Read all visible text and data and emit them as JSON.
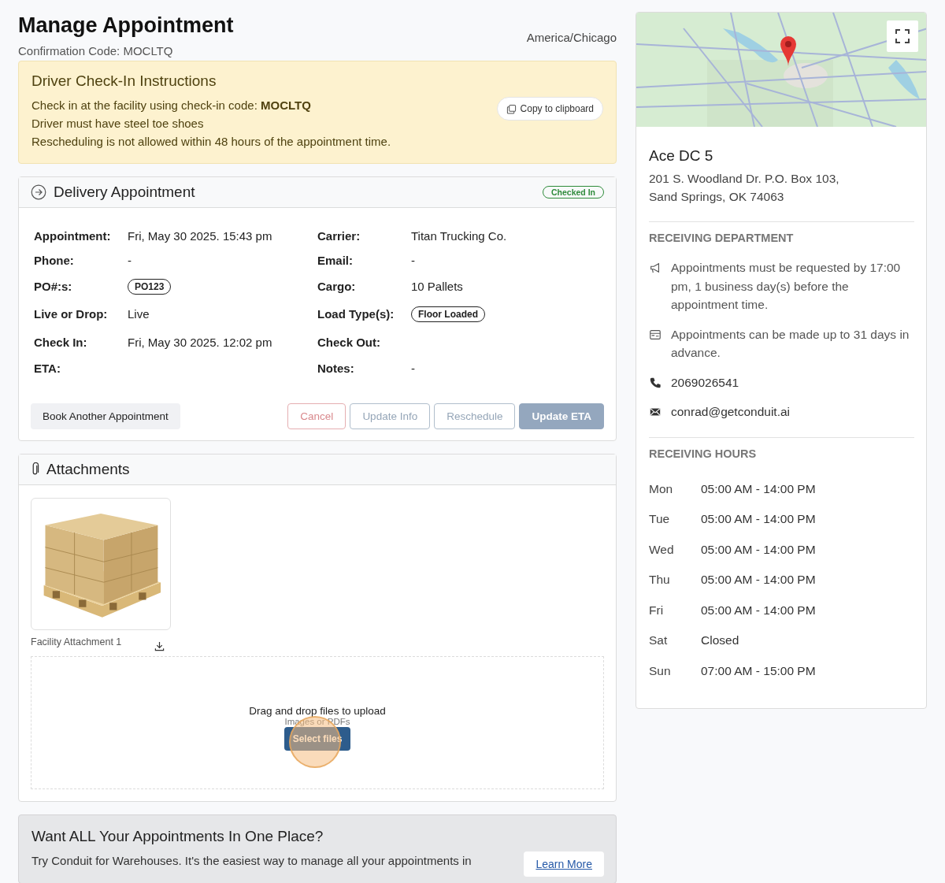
{
  "header": {
    "title": "Manage Appointment",
    "confirmation": "Confirmation Code: MOCLTQ",
    "timezone": "America/Chicago"
  },
  "instructions": {
    "title": "Driver Check-In Instructions",
    "lines": [
      "Check in at the facility using check-in code: **MOCLTQ**",
      "Driver must have steel toe shoes",
      "Rescheduling is not allowed within 48 hours of the appointment time."
    ],
    "copy_button": "Copy to clipboard"
  },
  "appointment": {
    "title": "Delivery Appointment",
    "status": "Checked In",
    "fields": [
      {
        "label": "Appointment:",
        "kind": "text",
        "value": "Fri, May 30 2025. 15:43 pm"
      },
      {
        "label": "Carrier:",
        "kind": "text",
        "value": "Titan Trucking Co."
      },
      {
        "label": "Phone:",
        "kind": "text",
        "value": "-"
      },
      {
        "label": "Email:",
        "kind": "text",
        "value": "-"
      },
      {
        "label": "PO#:s:",
        "kind": "tag",
        "value": "PO123"
      },
      {
        "label": "Cargo:",
        "kind": "text",
        "value": "10 Pallets"
      },
      {
        "label": "Live or Drop:",
        "kind": "text",
        "value": "Live"
      },
      {
        "label": "Load Type(s):",
        "kind": "tag",
        "value": "Floor Loaded"
      },
      {
        "label": "Check In:",
        "kind": "text",
        "value": "Fri, May 30 2025. 12:02 pm"
      },
      {
        "label": "Check Out:",
        "kind": "text"
      },
      {
        "label": "ETA:",
        "kind": "text"
      },
      {
        "label": "Notes:",
        "kind": "text",
        "value": "-"
      }
    ],
    "book_button": "Book Another Appointment",
    "actions": [
      {
        "label": "Cancel",
        "kind": "danger",
        "disabled": true
      },
      {
        "label": "Update Info",
        "kind": "outline",
        "disabled": true
      },
      {
        "label": "Reschedule",
        "kind": "outline",
        "disabled": true
      },
      {
        "label": "Update ETA",
        "kind": "primary",
        "disabled": true
      }
    ]
  },
  "attachments": {
    "title": "Attachments",
    "files": [
      {
        "name": "Facility Attachment 1",
        "kind": "picture"
      }
    ],
    "dropzone": {
      "text": "Drag and drop files to upload",
      "hint": "Images or PDFs",
      "button": "Select files"
    }
  },
  "promo": {
    "title": "Want ALL Your Appointments In One Place?",
    "text": "Try Conduit for Warehouses. It's the easiest way to manage all your appointments in",
    "link": "Learn More"
  },
  "location": {
    "name": "Ace DC 5",
    "address": [
      "201 S. Woodland Dr. P.O. Box 103,",
      "Sand Springs, OK 74063"
    ],
    "department_title": "RECEIVING DEPARTMENT",
    "notes": [
      {
        "kind": "megaphone",
        "text": "Appointments must be requested by 17:00 pm, 1 business day(s) before the appointment time."
      },
      {
        "kind": "calendar",
        "text": "Appointments can be made up to 31 days in advance."
      },
      {
        "kind": "phone",
        "text": "2069026541"
      },
      {
        "kind": "email",
        "text": "conrad@getconduit.ai"
      }
    ],
    "hours_title": "RECEIVING HOURS",
    "hours": [
      {
        "day": "Mon",
        "hours": "05:00 AM - 14:00 PM"
      },
      {
        "day": "Tue",
        "hours": "05:00 AM - 14:00 PM"
      },
      {
        "day": "Wed",
        "hours": "05:00 AM - 14:00 PM"
      },
      {
        "day": "Thu",
        "hours": "05:00 AM - 14:00 PM"
      },
      {
        "day": "Fri",
        "hours": "05:00 AM - 14:00 PM"
      },
      {
        "day": "Sat",
        "hours": "Closed"
      },
      {
        "day": "Sun",
        "hours": "07:00 AM - 15:00 PM"
      }
    ]
  }
}
